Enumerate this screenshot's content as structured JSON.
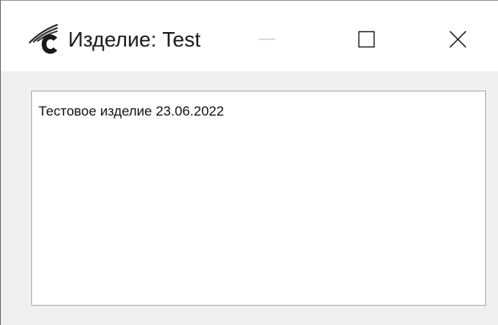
{
  "window": {
    "title": "Изделие: Test",
    "app_icon": "app-logo-c-icon",
    "accent_color": "#8a1f2a"
  },
  "titlebar": {
    "buttons": [
      {
        "name": "minimize",
        "icon": "minimize-icon",
        "enabled": false
      },
      {
        "name": "maximize",
        "icon": "maximize-icon",
        "enabled": true
      },
      {
        "name": "close",
        "icon": "close-icon",
        "enabled": true
      }
    ]
  },
  "content": {
    "text_value": "Тестовое изделие 23.06.2022"
  }
}
